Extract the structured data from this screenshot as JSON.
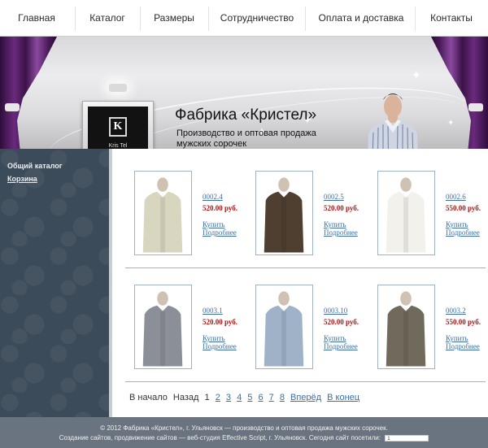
{
  "nav": {
    "items": [
      {
        "label": "Главная"
      },
      {
        "label": "Каталог"
      },
      {
        "label": "Размеры"
      },
      {
        "label": "Сотрудничество"
      },
      {
        "label": "Оплата и доставка"
      },
      {
        "label": "Контакты"
      }
    ]
  },
  "banner": {
    "title": "Фабрика «Кристел»",
    "subtitle": "Производство и оптовая продажа мужских сорочек",
    "logo_mark": "K",
    "logo_text": "Kris Tel"
  },
  "sidebar": {
    "items": [
      {
        "label": "Общий каталог"
      },
      {
        "label": "Корзина"
      }
    ]
  },
  "products": [
    {
      "code": "0002.4",
      "price": "520.00 руб.",
      "buy": "Купить",
      "details": "Подробнее",
      "shirt_color": "#d9d6c0"
    },
    {
      "code": "0002.5",
      "price": "520.00 руб.",
      "buy": "Купить",
      "details": "Подробнее",
      "shirt_color": "#4f3f30"
    },
    {
      "code": "0002.6",
      "price": "550.00 руб.",
      "buy": "Купить",
      "details": "Подробнее",
      "shirt_color": "#f2f1ec"
    },
    {
      "code": "0003.1",
      "price": "520.00 руб.",
      "buy": "Купить",
      "details": "Подробнее",
      "shirt_color": "#8b8f98"
    },
    {
      "code": "0003.10",
      "price": "520.00 руб.",
      "buy": "Купить",
      "details": "Подробнее",
      "shirt_color": "#9fb2c8"
    },
    {
      "code": "0003.2",
      "price": "550.00 руб.",
      "buy": "Купить",
      "details": "Подробнее",
      "shirt_color": "#6f6a5c"
    }
  ],
  "pager": {
    "first": "В начало",
    "prev": "Назад",
    "current": "1",
    "pages": [
      "2",
      "3",
      "4",
      "5",
      "6",
      "7",
      "8"
    ],
    "next": "Вперёд",
    "last": "В конец"
  },
  "footer": {
    "line1": "© 2012 Фабрика «Кристел», г. Ульяновск — производство и оптовая продажа мужских сорочек.",
    "line2": "Создание сайтов, продвижение сайтов — веб-студия Effective Script, г. Ульяновск. Сегодня сайт посетили:",
    "counter": "1"
  },
  "colors": {
    "link": "#3d6fa6",
    "price": "#b01212",
    "sidebar": "#3c4b5a",
    "footer": "#6a7480",
    "curtain": "#6a2a7d"
  }
}
